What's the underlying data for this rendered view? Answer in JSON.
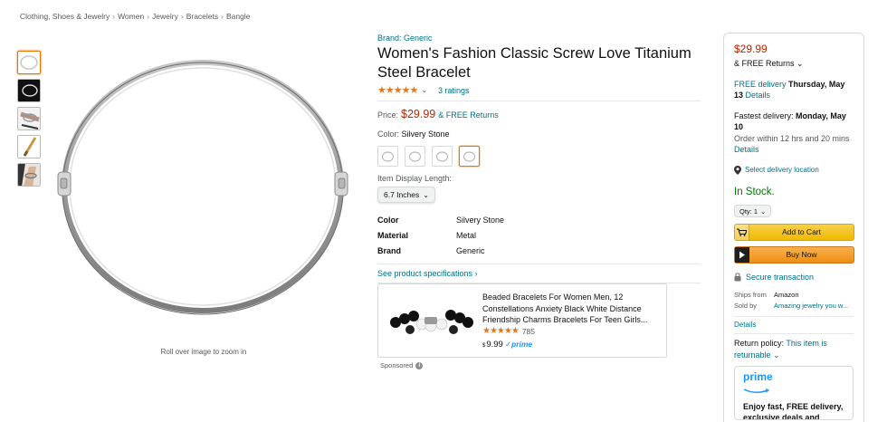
{
  "breadcrumb": [
    "Clothing, Shoes & Jewelry",
    "Women",
    "Jewelry",
    "Bracelets",
    "Bangle"
  ],
  "breadcrumb_sep": "›",
  "gallery": {
    "thumbnails": [
      "bracelet-white",
      "bracelet-black-bg",
      "bracelet-worn",
      "screwdriver",
      "bracelet-on-wrist"
    ],
    "zoom_hint": "Roll over image to zoom in"
  },
  "product": {
    "brand": "Brand: Generic",
    "title": "Women's Fashion Classic Screw Love Titanium Steel Bracelet",
    "stars": "★★★★★",
    "star_value": 4.5,
    "ratings": "3 ratings",
    "price_label": "Price:",
    "price": "$29.99",
    "price_returns": "& FREE Returns",
    "color_label": "Color:",
    "color_value": "Silvery Stone",
    "length_label": "Item Display Length:",
    "length_value": "6.7 Inches",
    "specs": [
      {
        "key": "Color",
        "value": "Silvery Stone"
      },
      {
        "key": "Material",
        "value": "Metal"
      },
      {
        "key": "Brand",
        "value": "Generic"
      }
    ],
    "see_specs": "See product specifications ›"
  },
  "sponsored_card": {
    "title": "Beaded Bracelets For Women Men, 12 Constellations Anxiety Black White Distance Friendship Charms Bracelets For Teen Girls...",
    "stars": "★★★★★",
    "rating_count": "785",
    "price_symbol": "$",
    "price": "9.99",
    "prime": "✓prime",
    "sponsored_label": "Sponsored"
  },
  "buy_box": {
    "price": "$29.99",
    "returns": "& FREE Returns ⌄",
    "free_delivery_label": "FREE delivery",
    "free_delivery_date": "Thursday, May 13",
    "details": "Details",
    "fastest_label": "Fastest delivery:",
    "fastest_date": "Monday, May 10",
    "order_within": "Order within 12 hrs and 20 mins",
    "select_location": "Select delivery location",
    "in_stock": "In Stock.",
    "qty": "Qty: 1",
    "add_to_cart": "Add to Cart",
    "buy_now": "Buy Now",
    "secure": "Secure transaction",
    "ships_from_label": "Ships from",
    "ships_from": "Amazon",
    "sold_by_label": "Sold by",
    "sold_by": "Amazing jewelry you w...",
    "details2": "Details",
    "return_policy_label": "Return policy:",
    "return_policy_value": "This item is returnable",
    "return_policy_chevron": "⌄",
    "prime_logo": "prime",
    "prime_text": "Enjoy fast, FREE delivery, exclusive deals and award-"
  },
  "colors": {
    "link": "#007185",
    "price": "#b12704",
    "instock": "#007600",
    "star": "#de7921",
    "add_to_cart": "#f7ca00",
    "buy_now": "#f08e12"
  }
}
